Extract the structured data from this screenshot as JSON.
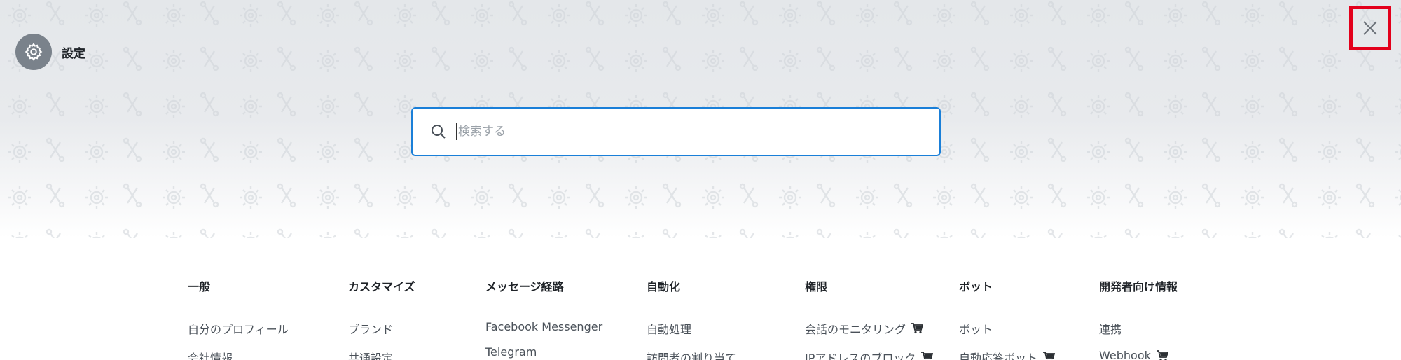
{
  "header": {
    "title": "設定",
    "settings_icon": "gear-icon",
    "close_icon": "close-icon",
    "close_highlight_color": "#e3001b"
  },
  "search": {
    "placeholder": "検索する",
    "value": "",
    "icon": "search-icon",
    "border_color": "#1a7fd8"
  },
  "categories": [
    {
      "heading": "一般",
      "items": [
        {
          "label": "自分のプロフィール",
          "cart": false
        },
        {
          "label": "会社情報",
          "cart": false
        }
      ]
    },
    {
      "heading": "カスタマイズ",
      "items": [
        {
          "label": "ブランド",
          "cart": false
        },
        {
          "label": "共通設定",
          "cart": false
        }
      ]
    },
    {
      "heading": "メッセージ経路",
      "items": [
        {
          "label": "Facebook Messenger",
          "cart": false
        },
        {
          "label": "Telegram",
          "cart": false
        }
      ]
    },
    {
      "heading": "自動化",
      "items": [
        {
          "label": "自動処理",
          "cart": false
        },
        {
          "label": "訪問者の割り当て",
          "cart": false
        }
      ]
    },
    {
      "heading": "権限",
      "items": [
        {
          "label": "会話のモニタリング",
          "cart": true
        },
        {
          "label": "IPアドレスのブロック",
          "cart": true
        }
      ]
    },
    {
      "heading": "ボット",
      "items": [
        {
          "label": "ボット",
          "cart": false
        },
        {
          "label": "自動応答ボット",
          "cart": true
        }
      ]
    },
    {
      "heading": "開発者向け情報",
      "items": [
        {
          "label": "連携",
          "cart": false
        },
        {
          "label": "Webhook",
          "cart": true
        }
      ]
    }
  ]
}
